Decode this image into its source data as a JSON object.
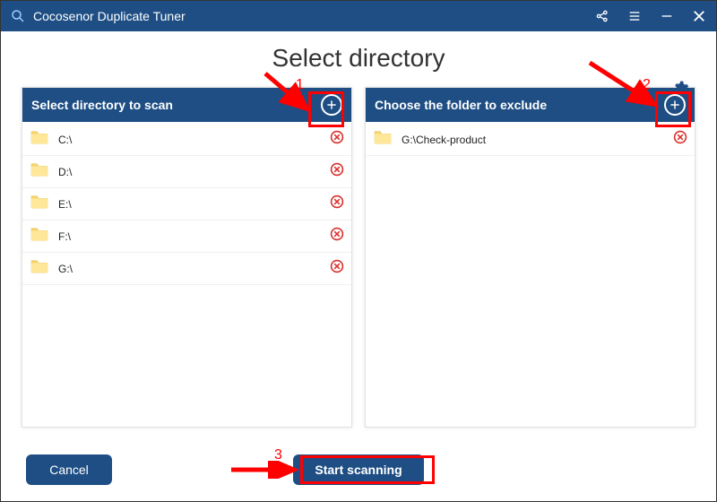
{
  "app": {
    "title": "Cocosenor Duplicate Tuner"
  },
  "page": {
    "title": "Select directory"
  },
  "panels": {
    "scan": {
      "title": "Select directory to scan",
      "items": [
        {
          "path": "C:\\"
        },
        {
          "path": "D:\\"
        },
        {
          "path": "E:\\"
        },
        {
          "path": "F:\\"
        },
        {
          "path": "G:\\"
        }
      ]
    },
    "exclude": {
      "title": "Choose the folder to exclude",
      "items": [
        {
          "path": "G:\\Check-product"
        }
      ]
    }
  },
  "footer": {
    "cancel": "Cancel",
    "start": "Start scanning"
  },
  "annotations": {
    "label1": "1",
    "label2": "2",
    "label3": "3"
  }
}
